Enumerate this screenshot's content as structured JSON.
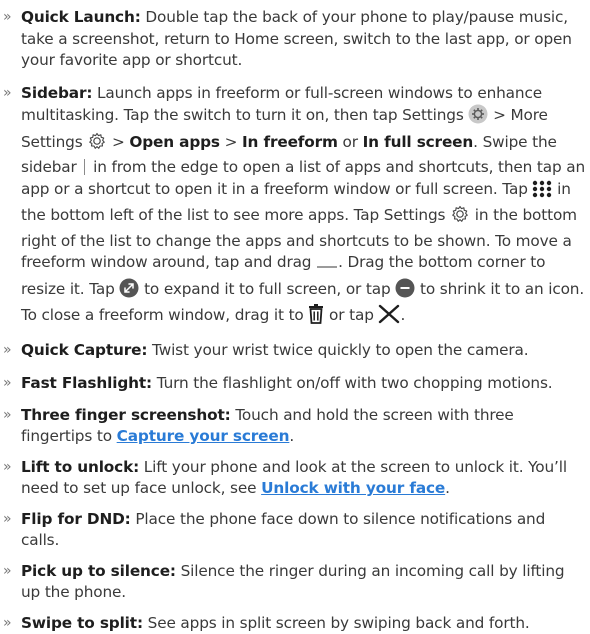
{
  "items": [
    {
      "title": "Quick Launch:",
      "text": " Double tap the back of your phone to play/pause music, take a screenshot, return to Home screen, switch to the last app, or open your favorite app or shortcut."
    },
    {
      "title": "Sidebar:",
      "t1": " Launch apps in freeform or full-screen windows to enhance multitasking. Tap the switch to turn it on, then tap Settings ",
      "t2": " > More Settings ",
      "t3": " > ",
      "b1": "Open apps",
      "t4": " > ",
      "b2": "In freeform",
      "t5": " or ",
      "b3": "In full screen",
      "t6": ". Swipe the sidebar ",
      "t7": " in from the edge to open a list of apps and shortcuts, then tap an app or a shortcut to open it in a freeform window or full screen. Tap ",
      "t8": " in the bottom left of the list to see more apps. Tap Settings ",
      "t9": " in the bottom right of the list to change the apps and shortcuts to be shown. To move a freeform window around, tap and drag ",
      "t10": ". Drag the bottom corner to resize it. Tap ",
      "t11": " to expand it to full screen, or tap ",
      "t12": " to shrink it to an icon. To close a freeform window, drag it to ",
      "t13": " or tap ",
      "t14": "."
    },
    {
      "title": "Quick Capture:",
      "text": " Twist your wrist twice quickly to open the camera."
    },
    {
      "title": "Fast Flashlight:",
      "text": " Turn the flashlight on/off with two chopping motions."
    },
    {
      "title": "Three finger screenshot:",
      "text": " Touch and hold the screen with three fingertips to ",
      "link": "Capture your screen",
      "after": "."
    },
    {
      "title": "Lift to unlock:",
      "text": " Lift your phone and look at the screen to unlock it. You’ll need to set up face unlock, see ",
      "link": "Unlock with your face",
      "after": "."
    },
    {
      "title": "Flip for DND:",
      "text": " Place the phone face down to silence notifications and calls."
    },
    {
      "title": "Pick up to silence:",
      "text": " Silence the ringer during an incoming call by lifting up the phone."
    },
    {
      "title": "Swipe to split:",
      "text": " See apps in split screen by swiping back and forth."
    }
  ],
  "colors": {
    "link": "#2a7bd6",
    "text": "#3a3a3a",
    "bold": "#1e1e1e"
  },
  "icons": [
    "settings-circle-icon",
    "settings-gear-icon",
    "sidebar-handle-icon",
    "grid-dots-icon",
    "drag-handle-icon",
    "expand-icon",
    "shrink-icon",
    "trash-icon",
    "close-x-icon"
  ]
}
